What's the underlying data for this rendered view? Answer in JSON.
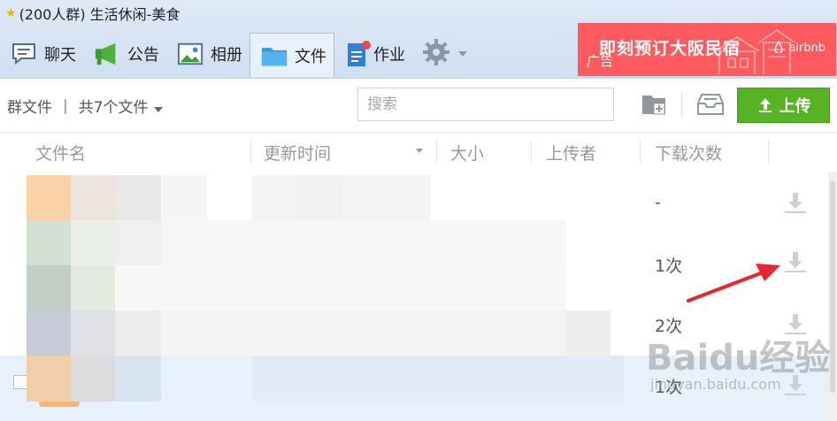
{
  "window": {
    "title": "(200人群) 生活休闲-美食"
  },
  "tabs": [
    {
      "label": "聊天",
      "icon": "chat-bubble-icon"
    },
    {
      "label": "公告",
      "icon": "megaphone-icon"
    },
    {
      "label": "相册",
      "icon": "photo-icon"
    },
    {
      "label": "文件",
      "icon": "folder-icon",
      "active": true
    },
    {
      "label": "作业",
      "icon": "homework-icon"
    }
  ],
  "ad": {
    "text": "即刻预订大阪民宿",
    "mark": "广告",
    "brand": "airbnb"
  },
  "toolbar": {
    "breadcrumb_root": "群文件",
    "breadcrumb_separator": "|",
    "file_count": "共7个文件",
    "search_placeholder": "搜索",
    "upload_label": "上传"
  },
  "columns": {
    "name": "文件名",
    "updated": "更新时间",
    "size": "大小",
    "uploader": "上传者",
    "downloads": "下载次数"
  },
  "files": [
    {
      "downloads": "-"
    },
    {
      "downloads": "1次"
    },
    {
      "downloads": "2次"
    },
    {
      "downloads": "1次"
    }
  ],
  "watermark": {
    "brand": "Baidu经验",
    "url": "jingyan.baidu.com"
  },
  "colors": {
    "accent": "#58b324",
    "annotation_arrow": "#e8262d",
    "ad_bg": "#ff5a60",
    "selected_row": "#e7f1fb"
  }
}
